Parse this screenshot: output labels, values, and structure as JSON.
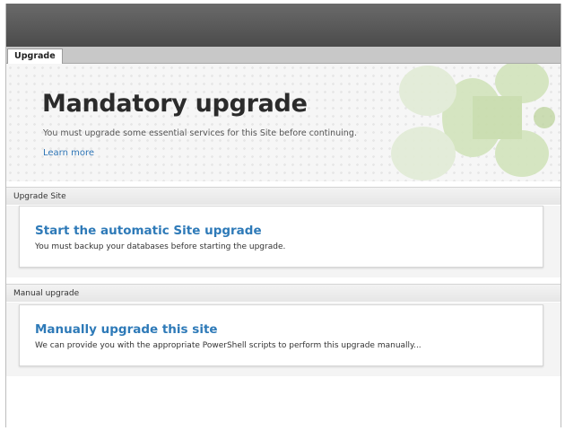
{
  "tab": {
    "label": "Upgrade"
  },
  "hero": {
    "title": "Mandatory upgrade",
    "description": "You must upgrade some essential services for this Site before continuing.",
    "link": "Learn more"
  },
  "sections": [
    {
      "header": "Upgrade Site",
      "card": {
        "title": "Start the automatic Site upgrade",
        "description": "You must backup your databases before starting the upgrade."
      }
    },
    {
      "header": "Manual upgrade",
      "card": {
        "title": "Manually upgrade this site",
        "description": "We can provide you with the appropriate PowerShell scripts to perform this upgrade manually..."
      }
    }
  ],
  "colors": {
    "link": "#2e75b6",
    "card_title": "#2e7ab8",
    "titlebar": "#555555",
    "decoration": "#c9dcb2"
  }
}
